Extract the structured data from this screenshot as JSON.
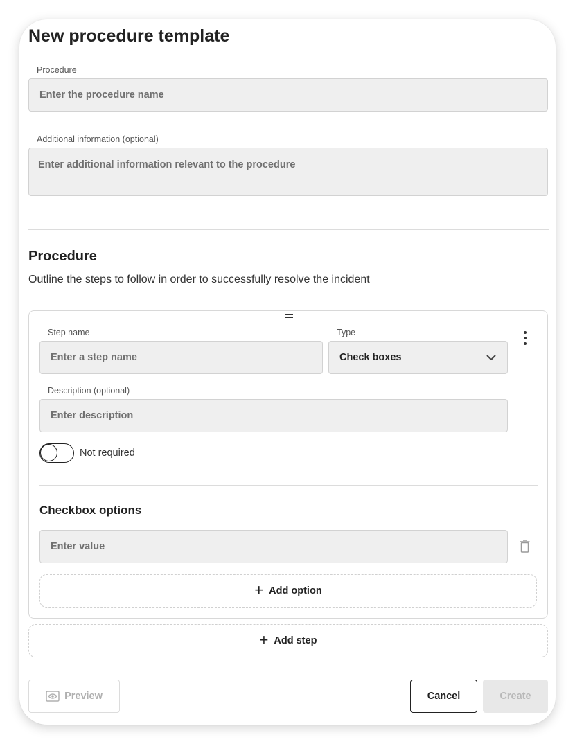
{
  "dialog": {
    "title": "New procedure template"
  },
  "procedure_field": {
    "label": "Procedure",
    "placeholder": "Enter the procedure name"
  },
  "additional_info_field": {
    "label": "Additional information (optional)",
    "placeholder": "Enter additional information relevant to the procedure"
  },
  "procedure_section": {
    "title": "Procedure",
    "description": "Outline the steps to follow in order to successfully resolve the incident"
  },
  "step": {
    "step_name_label": "Step name",
    "step_name_placeholder": "Enter a step name",
    "type_label": "Type",
    "type_value": "Check boxes",
    "description_label": "Description (optional)",
    "description_placeholder": "Enter description",
    "required_toggle_label": "Not required",
    "required_toggle_on": false,
    "checkbox_options_title": "Checkbox options",
    "option_placeholder": "Enter value",
    "add_option_label": "Add option"
  },
  "add_step_label": "Add step",
  "footer": {
    "preview_label": "Preview",
    "cancel_label": "Cancel",
    "create_label": "Create"
  },
  "icons": {
    "drag": "drag-handle-icon",
    "more": "more-vertical-icon",
    "chevron": "chevron-down-icon",
    "trash": "trash-icon",
    "plus": "plus-icon",
    "eye": "preview-icon"
  }
}
